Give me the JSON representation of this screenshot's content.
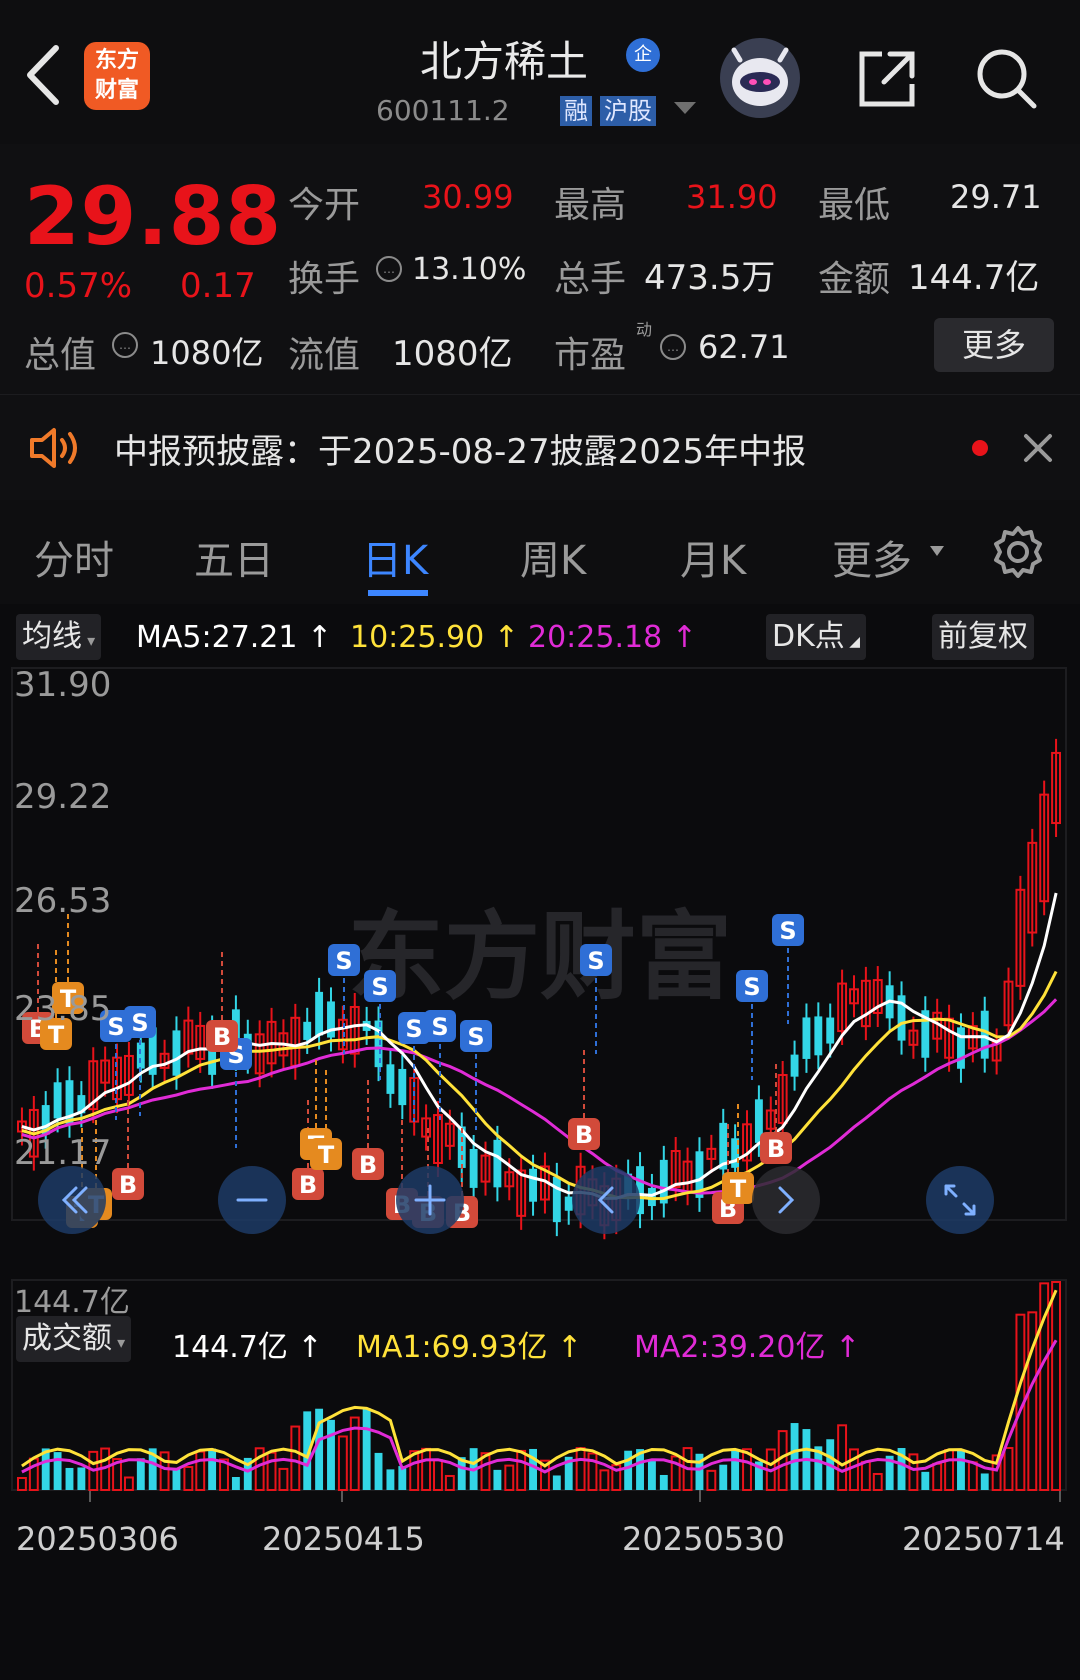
{
  "header": {
    "logo_text": "东方财富",
    "title": "北方稀土",
    "title_badge": "企",
    "code": "600111.2",
    "tags": [
      "融",
      "沪股"
    ]
  },
  "quote": {
    "price": "29.88",
    "change_pct": "0.57%",
    "change": "0.17",
    "open_label": "今开",
    "open": "30.99",
    "high_label": "最高",
    "high": "31.90",
    "low_label": "最低",
    "low": "29.71",
    "turnover_label": "换手",
    "turnover": "13.10%",
    "volume_label": "总手",
    "volume": "473.5万",
    "amount_label": "金额",
    "amount": "144.7亿",
    "total_value_label": "总值",
    "total_value": "1080亿",
    "float_value_label": "流值",
    "float_value": "1080亿",
    "pe_label": "市盈",
    "pe_sup": "动",
    "pe": "62.71",
    "more_label": "更多"
  },
  "notice": {
    "text": "中报预披露：于2025-08-27披露2025年中报"
  },
  "tabs": [
    "分时",
    "五日",
    "日K",
    "周K",
    "月K",
    "更多"
  ],
  "kline_bar": {
    "ma_select": "均线",
    "ma5": "MA5:27.21 ↑",
    "ma10": "10:25.90 ↑",
    "ma20": "20:25.18 ↑",
    "dk_label": "DK点",
    "adj_label": "前复权"
  },
  "price_axis": [
    "31.90",
    "29.22",
    "26.53",
    "23.85",
    "21.17"
  ],
  "volume_bar": {
    "select": "成交额",
    "value": "144.7亿 ↑",
    "ma1": "MA1:69.93亿 ↑",
    "ma2": "MA2:39.20亿 ↑",
    "axis_max": "144.7亿"
  },
  "dates": [
    "20250306",
    "20250415",
    "20250530",
    "20250714"
  ],
  "watermark": "东方财富",
  "colors": {
    "up": "#e8131a",
    "down": "#33d6e6",
    "ma5": "#ffffff",
    "ma10": "#ffe23a",
    "ma20": "#e02bd6",
    "accent": "#3d86ff"
  }
}
